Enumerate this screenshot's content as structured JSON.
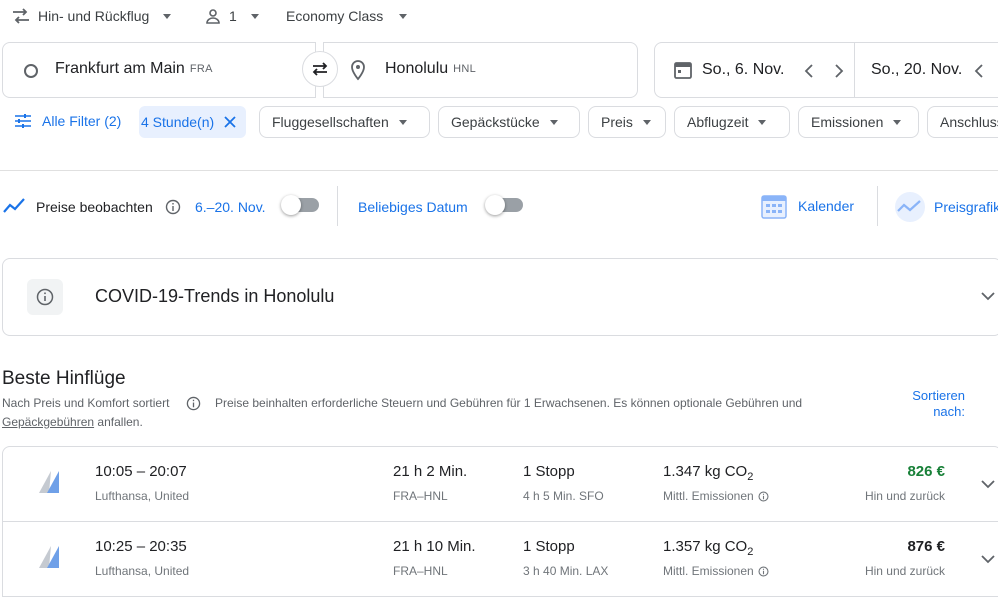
{
  "top": {
    "trip_type": "Hin- und Rückflug",
    "passengers": "1",
    "cabin": "Economy Class"
  },
  "search": {
    "origin_city": "Frankfurt am Main",
    "origin_code": "FRA",
    "destination_city": "Honolulu",
    "destination_code": "HNL",
    "depart_date": "So., 6. Nov.",
    "return_date": "So., 20. Nov."
  },
  "filters": {
    "all_filters": "Alle Filter (2)",
    "duration_chip": "4 Stunde(n)",
    "chips": [
      "Fluggesellschaften",
      "Gepäckstücke",
      "Preis",
      "Abflugzeit",
      "Emissionen",
      "Anschluss"
    ]
  },
  "tools": {
    "watch_label": "Preise beobachten",
    "watch_dates": "6.–20. Nov.",
    "any_date": "Beliebiges Datum",
    "calendar": "Kalender",
    "price_graph": "Preisgrafik"
  },
  "covid": {
    "title": "COVID-19-Trends in Honolulu"
  },
  "results": {
    "heading": "Beste Hinflüge",
    "sorted_by": "Nach Preis und Komfort sortiert",
    "note_part1": "Preise beinhalten erforderliche Steuern und Gebühren für 1 Erwachsenen. Es können optionale Gebühren und",
    "note_link": "Gepäckgebühren",
    "note_part2": "anfallen.",
    "sort_label_1": "Sortieren",
    "sort_label_2": "nach:",
    "flights": [
      {
        "times": "10:05 – 20:07",
        "airlines": "Lufthansa, United",
        "duration": "21 h 2 Min.",
        "route": "FRA–HNL",
        "stops": "1 Stopp",
        "layover": "4 h 5 Min. SFO",
        "co2_value": "1.347 kg CO",
        "co2_sub": "2",
        "emissions_label": "Mittl. Emissionen",
        "price": "826 €",
        "trip": "Hin und zurück"
      },
      {
        "times": "10:25 – 20:35",
        "airlines": "Lufthansa, United",
        "duration": "21 h 10 Min.",
        "route": "FRA–HNL",
        "stops": "1 Stopp",
        "layover": "3 h 40 Min. LAX",
        "co2_value": "1.357 kg CO",
        "co2_sub": "2",
        "emissions_label": "Mittl. Emissionen",
        "price": "876 €",
        "trip": "Hin und zurück"
      }
    ]
  },
  "colors": {
    "accent_blue": "#1a73e8",
    "price_green": "#188038",
    "chip_selected_bg": "#e8f0fe"
  }
}
